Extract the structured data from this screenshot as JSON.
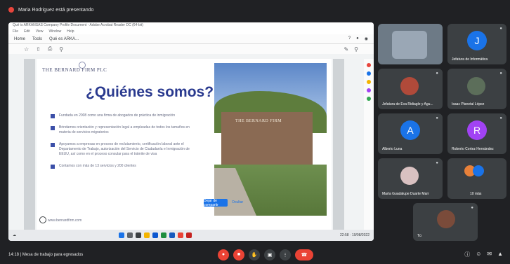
{
  "topbar": {
    "presenter_text": "Maria Rodriguez está presentando"
  },
  "doc": {
    "titlebar": "Qué is ARKANSAS Company Profile Document - Adobe Acrobat Reader DC (64-bit)",
    "menu": [
      "File",
      "Edit",
      "View",
      "Window",
      "Help"
    ],
    "toolbar": [
      "Home",
      "Tools",
      "Qué es ARKA..."
    ],
    "slide": {
      "logo": "THE BERNARD FIRM PLC",
      "title": "¿Quiénes somos?",
      "bullets": [
        "Fundada en 2008 como una firma de abogados de práctica de inmigración",
        "Brindamos orientación y representación legal a empleadas de todos los tamaños en materia de servicios migratorios",
        "Apoyamos a empresas en proceso de reclutamiento, certificación laboral ante el Departamento de Trabajo, autorización del Servicio de Ciudadanía e Inmigración de EEUU, así como en el proceso consular para el trámite de visa",
        "Contamos con más de 13 servicios y 200 clientes"
      ],
      "sign_text": "THE BERNARD FIRM",
      "footer": "www.bernardfirm.com",
      "stop_label": "Dejar de compartir",
      "hide_label": "Ocultar"
    },
    "taskbar_time": "22:58 · 19/08/2022"
  },
  "participants": [
    {
      "name": "Jefatura de Informática",
      "initial": "J",
      "color": "#1a73e8"
    },
    {
      "name": "Jefatura de Eva Ridiagle y Agu...",
      "initial": "",
      "color": ""
    },
    {
      "name": "Isaac Planetal López",
      "initial": "",
      "color": ""
    },
    {
      "name": "Alberto Luna",
      "initial": "A",
      "color": "#1a73e8"
    },
    {
      "name": "Roberto Cortez Hernández",
      "initial": "R",
      "color": "#a142f4"
    },
    {
      "name": "María Guadalupe Duarte Marr",
      "initial": "",
      "color": ""
    },
    {
      "name": "10 más",
      "initial": "",
      "color": ""
    },
    {
      "name": "Tú",
      "initial": "",
      "color": ""
    }
  ],
  "bottombar": {
    "meeting_info": "14:18  |  Mesa de trabajo para egresados"
  },
  "colors": {
    "accent": "#1a73e8",
    "danger": "#ea4335",
    "bg": "#202124",
    "tile": "#3c4043"
  }
}
